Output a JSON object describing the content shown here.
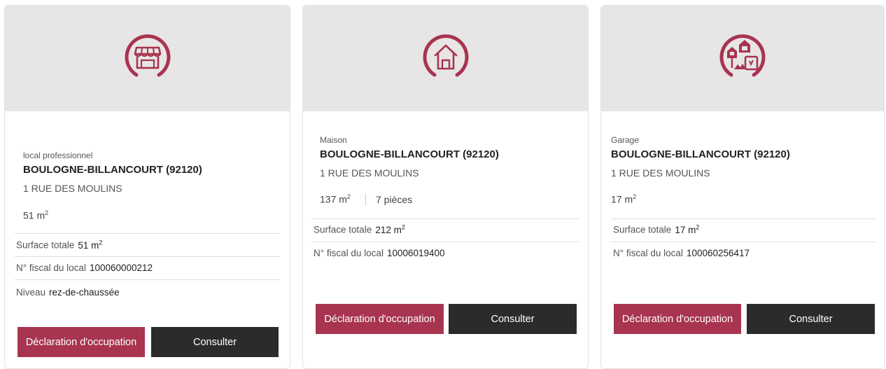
{
  "colors": {
    "accent": "#a8344f",
    "dark_button": "#2b2b2b",
    "header_bg": "#e7e5e5"
  },
  "cards": [
    {
      "icon": "shop-icon",
      "category": "local professionnel",
      "city": "BOULOGNE-BILLANCOURT (92120)",
      "address": "1 RUE DES MOULINS",
      "area": "51 m",
      "area_exp": "2",
      "details": {
        "surface_label": "Surface totale",
        "surface_value": "51 m",
        "surface_exp": "2",
        "fiscal_label": "N° fiscal du local",
        "fiscal_value": "100060000212",
        "level_label": "Niveau",
        "level_value": "rez-de-chaussée"
      },
      "declaration_label": "Déclaration d'occupation",
      "consult_label": "Consulter"
    },
    {
      "icon": "house-icon",
      "category": "Maison",
      "city": "BOULOGNE-BILLANCOURT (92120)",
      "address": "1 RUE DES MOULINS",
      "area": "137 m",
      "area_exp": "2",
      "rooms": "7 pièces",
      "details": {
        "surface_label": "Surface totale",
        "surface_value": "212 m",
        "surface_exp": "2",
        "fiscal_label": "N° fiscal du local",
        "fiscal_value": "10006019400"
      },
      "declaration_label": "Déclaration d'occupation",
      "consult_label": "Consulter"
    },
    {
      "icon": "mixed-properties-icon",
      "category": "Garage",
      "city": "BOULOGNE-BILLANCOURT (92120)",
      "address": "1 RUE DES MOULINS",
      "area": "17 m",
      "area_exp": "2",
      "details": {
        "surface_label": "Surface totale",
        "surface_value": "17 m",
        "surface_exp": "2",
        "fiscal_label": "N° fiscal du local",
        "fiscal_value": "100060256417"
      },
      "declaration_label": "Déclaration d'occupation",
      "consult_label": "Consulter"
    }
  ]
}
